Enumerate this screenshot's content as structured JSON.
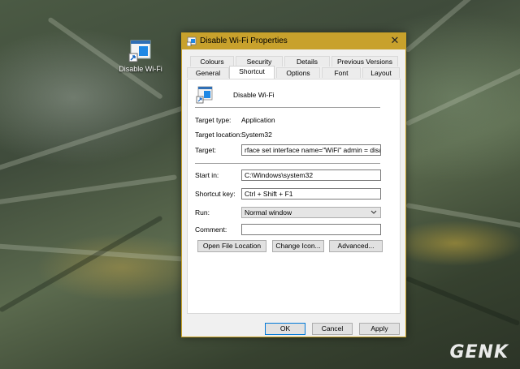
{
  "desktop": {
    "icon_label": "Disable Wi-Fi"
  },
  "window": {
    "title": "Disable Wi-Fi Properties",
    "close_glyph": "✕"
  },
  "tabs": {
    "row1": [
      "Colours",
      "Security",
      "Details",
      "Previous Versions"
    ],
    "row2": [
      "General",
      "Shortcut",
      "Options",
      "Font",
      "Layout"
    ],
    "active": "Shortcut"
  },
  "shortcut": {
    "name": "Disable Wi-Fi",
    "target_type_label": "Target type:",
    "target_type_value": "Application",
    "target_location_label": "Target location:",
    "target_location_value": "System32",
    "target_label": "Target:",
    "target_value": "rface set interface name=\"WiFi\" admin = disabled",
    "start_in_label": "Start in:",
    "start_in_value": "C:\\Windows\\system32",
    "shortcut_key_label": "Shortcut key:",
    "shortcut_key_value": "Ctrl + Shift + F1",
    "run_label": "Run:",
    "run_value": "Normal window",
    "comment_label": "Comment:",
    "comment_value": "",
    "open_file_location": "Open File Location",
    "change_icon": "Change Icon...",
    "advanced": "Advanced..."
  },
  "footer": {
    "ok": "OK",
    "cancel": "Cancel",
    "apply": "Apply"
  },
  "colors": {
    "titlebar": "#c8a12c",
    "accent_blue": "#0078d7"
  },
  "icons": {
    "desktop_shortcut": "shortcut-window-icon",
    "close": "close-icon",
    "dropdown": "chevron-down-icon"
  },
  "watermark": "GENK"
}
